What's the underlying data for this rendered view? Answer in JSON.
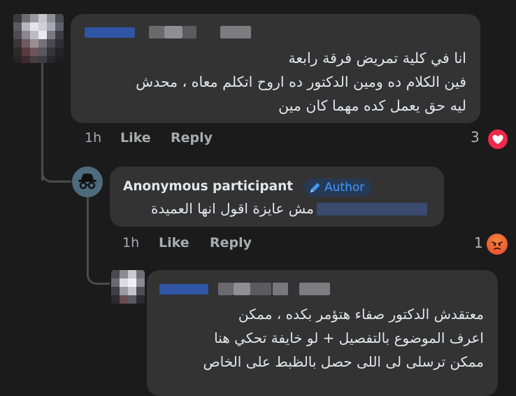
{
  "comment1": {
    "lines": [
      "انا في كلية تمريض فرقة رابعة",
      "فين الكلام ده ومين الدكتور ده اروح اتكلم معاه ، محدش",
      "ليه حق يعمل كده مهما كان مين"
    ],
    "time": "1h",
    "like": "Like",
    "reply": "Reply",
    "reaction_count": "3",
    "reaction_icon": "love-heart-icon",
    "reaction_color": "#f0284a"
  },
  "comment2": {
    "author": "Anonymous participant",
    "badge": "Author",
    "badge_color": "#4599ff",
    "text": "مش عايزة اقول انها العميدة",
    "time": "1h",
    "like": "Like",
    "reply": "Reply",
    "reaction_count": "1",
    "reaction_icon": "angry-face-icon",
    "reaction_color": "#f15a3a"
  },
  "comment3": {
    "lines": [
      "معتقدش الدكتور صفاء هتؤمر بكده ، ممكن",
      "اعرف الموضوع بالتفصيل + لو خايفة تحكي هنا",
      "ممكن ترسلى لى اللى حصل بالظبط على الخاص"
    ]
  }
}
